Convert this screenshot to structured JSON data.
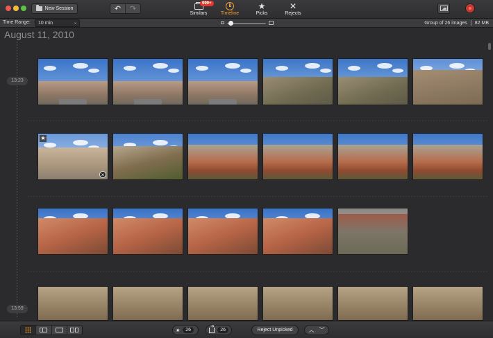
{
  "toolbar": {
    "new_session_label": "New Session",
    "undo_glyph": "↶",
    "redo_glyph": "↷",
    "modes": [
      {
        "label": "Similars",
        "badge": "999+",
        "icon": "stack-icon"
      },
      {
        "label": "Timeline",
        "icon": "clock-icon",
        "active": true
      },
      {
        "label": "Picks",
        "icon": "star-icon"
      },
      {
        "label": "Rejects",
        "icon": "x-icon"
      }
    ]
  },
  "subbar": {
    "time_range_label": "Time Range:",
    "time_range_value": "10 min",
    "group_info": "Group of 26 images",
    "size_info": "82 MB",
    "zoom_level": 0.05
  },
  "main": {
    "date_heading": "August 11, 2010",
    "time_markers": [
      "13:23",
      "13:59"
    ],
    "rows": [
      [
        {
          "scene": "hills-road",
          "starred": false
        },
        {
          "scene": "hills-road",
          "starred": false
        },
        {
          "scene": "hills-road",
          "starred": false
        },
        {
          "scene": "slope",
          "starred": false
        },
        {
          "scene": "slope",
          "starred": false
        },
        {
          "scene": "slope-brown",
          "starred": false
        }
      ],
      [
        {
          "scene": "tan-hill",
          "starred": true,
          "rejected": true
        },
        {
          "scene": "shrub-slope",
          "starred": false
        },
        {
          "scene": "red-cliff",
          "starred": false
        },
        {
          "scene": "red-cliff",
          "starred": false
        },
        {
          "scene": "red-cliff",
          "starred": false
        },
        {
          "scene": "red-cliff",
          "starred": false
        }
      ],
      [
        {
          "scene": "red-rock",
          "starred": false
        },
        {
          "scene": "red-rock",
          "starred": false
        },
        {
          "scene": "red-rock",
          "starred": false
        },
        {
          "scene": "red-rock",
          "starred": false
        },
        {
          "scene": "gray-hill",
          "starred": false
        }
      ],
      [
        {
          "scene": "tan-rock",
          "starred": false
        },
        {
          "scene": "tan-rock",
          "starred": false
        },
        {
          "scene": "tan-rock",
          "starred": false
        },
        {
          "scene": "tan-rock",
          "starred": false
        },
        {
          "scene": "tan-rock",
          "starred": false
        },
        {
          "scene": "tan-rock",
          "starred": false
        }
      ]
    ]
  },
  "bottombar": {
    "picks_count": "26",
    "share_count": "26",
    "reject_unpicked_label": "Reject Unpicked",
    "up_glyph": "︿",
    "down_glyph": "﹀"
  },
  "colors": {
    "accent": "#f0a13a",
    "badge": "#e0382e"
  }
}
